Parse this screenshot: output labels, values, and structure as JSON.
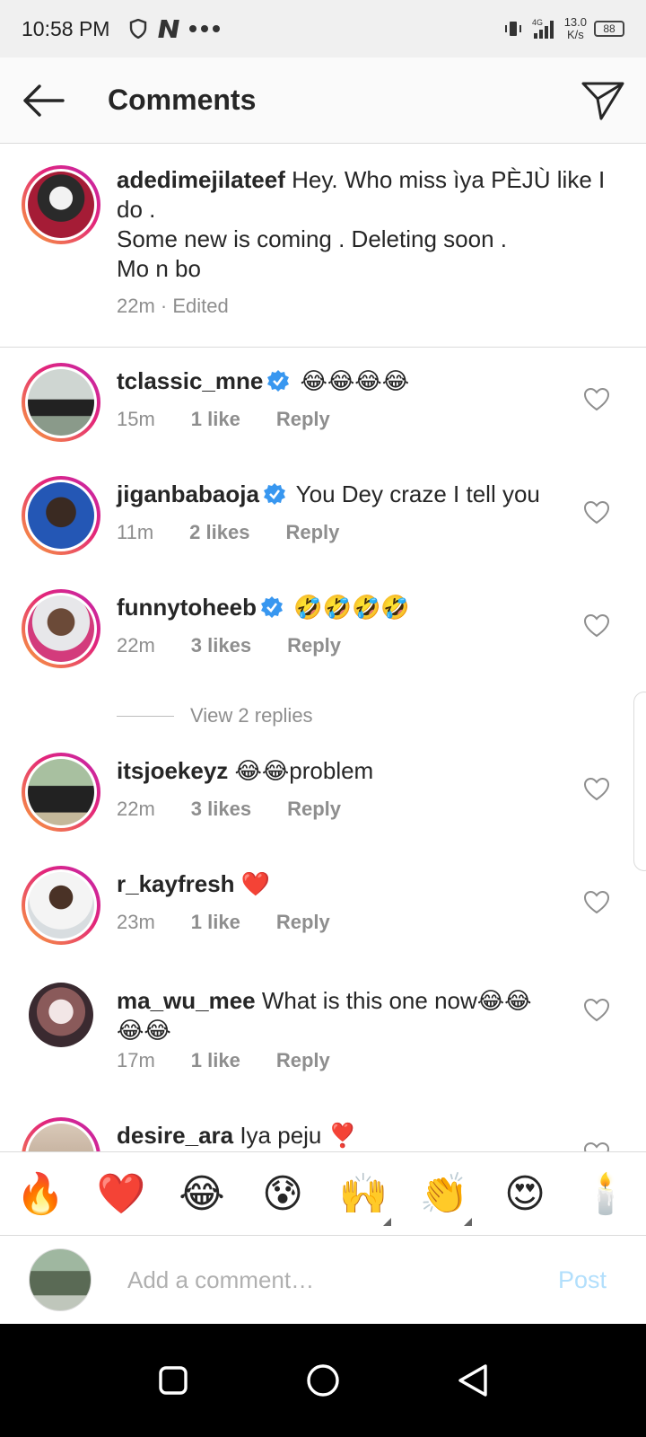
{
  "status_bar": {
    "time": "10:58 PM",
    "net_speed_value": "13.0",
    "net_speed_unit": "K/s",
    "signal": "4G",
    "battery": "88"
  },
  "header": {
    "title": "Comments"
  },
  "caption": {
    "username": "adedimejilateef",
    "text": " Hey. Who miss ìya PÈJÙ like I do .\nSome new is coming . Deleting soon .\nMo n bo",
    "meta": "22m · Edited"
  },
  "comments": [
    {
      "username": "tclassic_mne",
      "verified": true,
      "text": " 😂😂😂😂",
      "time": "15m",
      "likes": "1 like",
      "reply": "Reply"
    },
    {
      "username": "jiganbabaoja",
      "verified": true,
      "text": " You Dey craze I tell you",
      "time": "11m",
      "likes": "2 likes",
      "reply": "Reply"
    },
    {
      "username": "funnytoheeb",
      "verified": true,
      "text": " 🤣🤣🤣🤣",
      "time": "22m",
      "likes": "3 likes",
      "reply": "Reply"
    },
    {
      "username": "itsjoekeyz",
      "verified": false,
      "text": " 😂😂problem",
      "time": "22m",
      "likes": "3 likes",
      "reply": "Reply"
    },
    {
      "username": "r_kayfresh",
      "verified": false,
      "text": " ❤️",
      "time": "23m",
      "likes": "1 like",
      "reply": "Reply"
    },
    {
      "username": "ma_wu_mee",
      "verified": false,
      "text": " What is this one now😂😂😂😂",
      "time": "17m",
      "likes": "1 like",
      "reply": "Reply"
    },
    {
      "username": "desire_ara",
      "verified": false,
      "text": " Iya peju ❣️"
    }
  ],
  "view_replies": "View 2 replies",
  "emoji_bar": [
    "🔥",
    "❤️",
    "😂",
    "😰",
    "🙌",
    "👏",
    "😍",
    "🕯️"
  ],
  "input": {
    "placeholder": "Add a comment…",
    "post_label": "Post"
  },
  "colors": {
    "accent": "#0095f6",
    "post_disabled": "#b2dffc",
    "muted": "#8e8e8e"
  }
}
